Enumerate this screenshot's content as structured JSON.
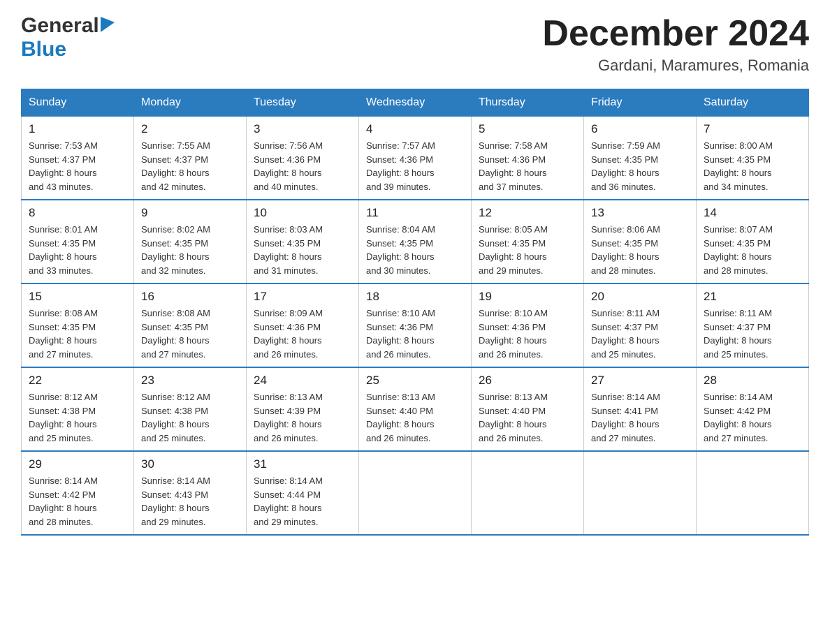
{
  "logo": {
    "general": "General",
    "blue": "Blue",
    "triangle": "▶"
  },
  "title": "December 2024",
  "location": "Gardani, Maramures, Romania",
  "days_of_week": [
    "Sunday",
    "Monday",
    "Tuesday",
    "Wednesday",
    "Thursday",
    "Friday",
    "Saturday"
  ],
  "weeks": [
    [
      {
        "day": "1",
        "sunrise": "7:53 AM",
        "sunset": "4:37 PM",
        "daylight": "8 hours and 43 minutes."
      },
      {
        "day": "2",
        "sunrise": "7:55 AM",
        "sunset": "4:37 PM",
        "daylight": "8 hours and 42 minutes."
      },
      {
        "day": "3",
        "sunrise": "7:56 AM",
        "sunset": "4:36 PM",
        "daylight": "8 hours and 40 minutes."
      },
      {
        "day": "4",
        "sunrise": "7:57 AM",
        "sunset": "4:36 PM",
        "daylight": "8 hours and 39 minutes."
      },
      {
        "day": "5",
        "sunrise": "7:58 AM",
        "sunset": "4:36 PM",
        "daylight": "8 hours and 37 minutes."
      },
      {
        "day": "6",
        "sunrise": "7:59 AM",
        "sunset": "4:35 PM",
        "daylight": "8 hours and 36 minutes."
      },
      {
        "day": "7",
        "sunrise": "8:00 AM",
        "sunset": "4:35 PM",
        "daylight": "8 hours and 34 minutes."
      }
    ],
    [
      {
        "day": "8",
        "sunrise": "8:01 AM",
        "sunset": "4:35 PM",
        "daylight": "8 hours and 33 minutes."
      },
      {
        "day": "9",
        "sunrise": "8:02 AM",
        "sunset": "4:35 PM",
        "daylight": "8 hours and 32 minutes."
      },
      {
        "day": "10",
        "sunrise": "8:03 AM",
        "sunset": "4:35 PM",
        "daylight": "8 hours and 31 minutes."
      },
      {
        "day": "11",
        "sunrise": "8:04 AM",
        "sunset": "4:35 PM",
        "daylight": "8 hours and 30 minutes."
      },
      {
        "day": "12",
        "sunrise": "8:05 AM",
        "sunset": "4:35 PM",
        "daylight": "8 hours and 29 minutes."
      },
      {
        "day": "13",
        "sunrise": "8:06 AM",
        "sunset": "4:35 PM",
        "daylight": "8 hours and 28 minutes."
      },
      {
        "day": "14",
        "sunrise": "8:07 AM",
        "sunset": "4:35 PM",
        "daylight": "8 hours and 28 minutes."
      }
    ],
    [
      {
        "day": "15",
        "sunrise": "8:08 AM",
        "sunset": "4:35 PM",
        "daylight": "8 hours and 27 minutes."
      },
      {
        "day": "16",
        "sunrise": "8:08 AM",
        "sunset": "4:35 PM",
        "daylight": "8 hours and 27 minutes."
      },
      {
        "day": "17",
        "sunrise": "8:09 AM",
        "sunset": "4:36 PM",
        "daylight": "8 hours and 26 minutes."
      },
      {
        "day": "18",
        "sunrise": "8:10 AM",
        "sunset": "4:36 PM",
        "daylight": "8 hours and 26 minutes."
      },
      {
        "day": "19",
        "sunrise": "8:10 AM",
        "sunset": "4:36 PM",
        "daylight": "8 hours and 26 minutes."
      },
      {
        "day": "20",
        "sunrise": "8:11 AM",
        "sunset": "4:37 PM",
        "daylight": "8 hours and 25 minutes."
      },
      {
        "day": "21",
        "sunrise": "8:11 AM",
        "sunset": "4:37 PM",
        "daylight": "8 hours and 25 minutes."
      }
    ],
    [
      {
        "day": "22",
        "sunrise": "8:12 AM",
        "sunset": "4:38 PM",
        "daylight": "8 hours and 25 minutes."
      },
      {
        "day": "23",
        "sunrise": "8:12 AM",
        "sunset": "4:38 PM",
        "daylight": "8 hours and 25 minutes."
      },
      {
        "day": "24",
        "sunrise": "8:13 AM",
        "sunset": "4:39 PM",
        "daylight": "8 hours and 26 minutes."
      },
      {
        "day": "25",
        "sunrise": "8:13 AM",
        "sunset": "4:40 PM",
        "daylight": "8 hours and 26 minutes."
      },
      {
        "day": "26",
        "sunrise": "8:13 AM",
        "sunset": "4:40 PM",
        "daylight": "8 hours and 26 minutes."
      },
      {
        "day": "27",
        "sunrise": "8:14 AM",
        "sunset": "4:41 PM",
        "daylight": "8 hours and 27 minutes."
      },
      {
        "day": "28",
        "sunrise": "8:14 AM",
        "sunset": "4:42 PM",
        "daylight": "8 hours and 27 minutes."
      }
    ],
    [
      {
        "day": "29",
        "sunrise": "8:14 AM",
        "sunset": "4:42 PM",
        "daylight": "8 hours and 28 minutes."
      },
      {
        "day": "30",
        "sunrise": "8:14 AM",
        "sunset": "4:43 PM",
        "daylight": "8 hours and 29 minutes."
      },
      {
        "day": "31",
        "sunrise": "8:14 AM",
        "sunset": "4:44 PM",
        "daylight": "8 hours and 29 minutes."
      },
      null,
      null,
      null,
      null
    ]
  ]
}
